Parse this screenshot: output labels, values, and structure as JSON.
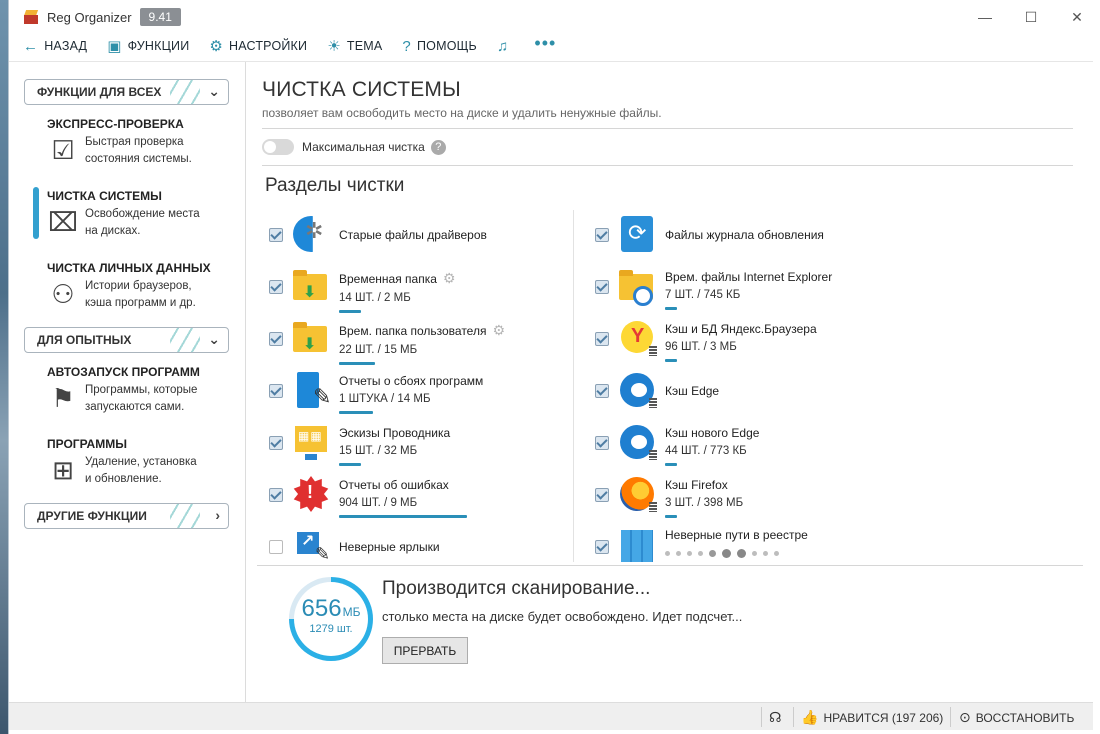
{
  "app": {
    "title": "Reg Organizer",
    "version": "9.41"
  },
  "window_controls": {
    "minimize": "—",
    "maximize": "☐",
    "close": "✕"
  },
  "toolbar": {
    "back": "НАЗАД",
    "functions": "ФУНКЦИИ",
    "settings": "НАСТРОЙКИ",
    "theme": "ТЕМА",
    "help": "ПОМОЩЬ",
    "more": "•••"
  },
  "sidebar": {
    "section_all": "ФУНКЦИИ ДЛЯ ВСЕХ",
    "section_advanced": "ДЛЯ ОПЫТНЫХ",
    "section_other": "ДРУГИЕ ФУНКЦИИ",
    "items": [
      {
        "title": "ЭКСПРЕСС-ПРОВЕРКА",
        "desc1": "Быстрая проверка",
        "desc2": "состояния системы.",
        "icon": "check-icon"
      },
      {
        "title": "ЧИСТКА СИСТЕМЫ",
        "desc1": "Освобождение места",
        "desc2": "на дисках.",
        "icon": "broom-icon",
        "active": true
      },
      {
        "title": "ЧИСТКА ЛИЧНЫХ ДАННЫХ",
        "desc1": "Истории браузеров,",
        "desc2": "кэша программ и др.",
        "icon": "privacy-icon"
      },
      {
        "title": "АВТОЗАПУСК ПРОГРАММ",
        "desc1": "Программы, которые",
        "desc2": "запускаются сами.",
        "icon": "autostart-icon"
      },
      {
        "title": "ПРОГРАММЫ",
        "desc1": "Удаление, установка",
        "desc2": "и обновление.",
        "icon": "programs-icon"
      }
    ]
  },
  "main": {
    "title": "ЧИСТКА СИСТЕМЫ",
    "subtitle": "позволяет вам освободить место на диске и удалить ненужные файлы.",
    "max_clean": "Максимальная чистка",
    "sections_title": "Разделы чистки",
    "left_items": [
      {
        "name": "Старые файлы драйверов",
        "value": "",
        "checked": true,
        "gear": false,
        "bar": 0
      },
      {
        "name": "Временная папка",
        "value": "14 ШТ. / 2 МБ",
        "checked": true,
        "gear": true,
        "bar": 0.18
      },
      {
        "name": "Врем. папка пользователя",
        "value": "22 ШТ. / 15 МБ",
        "checked": true,
        "gear": true,
        "bar": 0.28
      },
      {
        "name": "Отчеты о сбоях программ",
        "value": "1 ШТУКА / 14 МБ",
        "checked": true,
        "gear": false,
        "bar": 0.26
      },
      {
        "name": "Эскизы Проводника",
        "value": "15 ШТ. / 32 МБ",
        "checked": true,
        "gear": false,
        "bar": 0.17
      },
      {
        "name": "Отчеты об ошибках",
        "value": "904 ШТ. / 9 МБ",
        "checked": true,
        "gear": false,
        "bar": 1.0
      },
      {
        "name": "Неверные ярлыки",
        "value": "",
        "checked": false,
        "gear": false,
        "bar": 0
      }
    ],
    "right_items": [
      {
        "name": "Файлы журнала обновления",
        "value": "",
        "checked": true,
        "bar": 0
      },
      {
        "name": "Врем. файлы Internet Explorer",
        "value": "7 ШТ. / 745 КБ",
        "checked": true,
        "bar": 0.09
      },
      {
        "name": "Кэш и БД Яндекс.Браузера",
        "value": "96 ШТ. / 3 МБ",
        "checked": true,
        "bar": 0.09
      },
      {
        "name": "Кэш Edge",
        "value": "",
        "checked": true,
        "bar": 0
      },
      {
        "name": "Кэш нового Edge",
        "value": "44 ШТ. / 773 КБ",
        "checked": true,
        "bar": 0.09
      },
      {
        "name": "Кэш Firefox",
        "value": "3 ШТ. / 398 МБ",
        "checked": true,
        "bar": 0.09
      },
      {
        "name": "Неверные пути в реестре",
        "value": "",
        "checked": true,
        "bar": 0
      }
    ]
  },
  "scan": {
    "amount": "656",
    "unit": "МБ",
    "count": "1279 шт.",
    "progress": 0.75,
    "title": "Производится сканирование...",
    "subtitle": "столько места на диске будет освобождено. Идет подсчет...",
    "stop": "ПРЕРВАТЬ"
  },
  "statusbar": {
    "likes": "НРАВИТСЯ (197 206)",
    "restore": "ВОССТАНОВИТЬ"
  }
}
